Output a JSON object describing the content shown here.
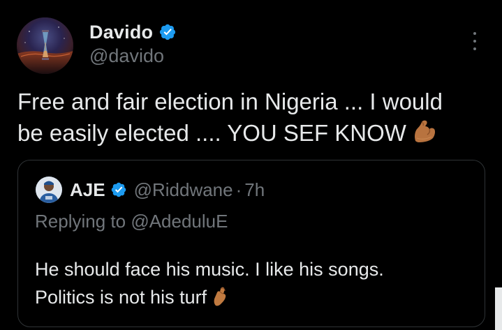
{
  "author": {
    "display_name": "Davido",
    "handle": "@davido",
    "verified": true,
    "verified_icon": "verified-badge-icon",
    "avatar_icon": "hourglass-landscape-avatar"
  },
  "menu_icon": "more-options-icon",
  "tweet": {
    "line1": "Free and fair election in Nigeria ... I would",
    "line2": "be easily elected .... YOU SEF KNOW",
    "emoji": "flexed-biceps-emoji"
  },
  "quote": {
    "display_name": "AJE",
    "handle": "@Riddwane",
    "separator": "·",
    "time": "7h",
    "verified": true,
    "reply_prefix": "Replying to",
    "reply_target": "@AdeduluE",
    "line1": "He should face his music. I like his songs.",
    "line2": "Politics is not his turf",
    "emoji": "pinching-hand-emoji"
  },
  "colors": {
    "background": "#000000",
    "text_primary": "#e7e9ea",
    "text_secondary": "#71767b",
    "verified_blue": "#1d9bf0",
    "border": "#2f3336"
  }
}
